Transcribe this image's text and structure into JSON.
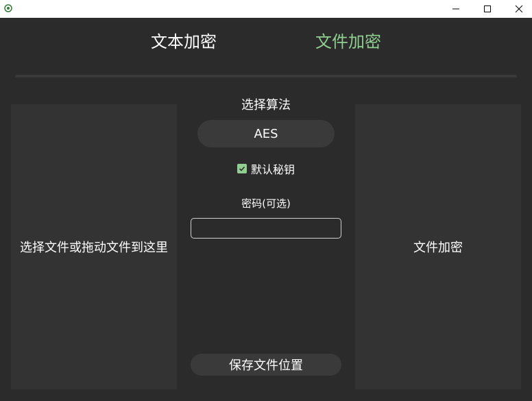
{
  "window": {
    "icons": {
      "app": "app-logo-icon",
      "minimize": "minimize-icon",
      "maximize": "maximize-icon",
      "close": "close-icon"
    }
  },
  "tabs": [
    {
      "label": "文本加密",
      "active": false
    },
    {
      "label": "文件加密",
      "active": true
    }
  ],
  "colors": {
    "background": "#2b2b2b",
    "panel": "#333333",
    "accent": "#8fcf8f"
  },
  "left_panel": {
    "label": "选择文件或拖动文件到这里"
  },
  "algorithm": {
    "label": "选择算法",
    "selected": "AES"
  },
  "default_key": {
    "label": "默认秘钥",
    "checked": true
  },
  "password": {
    "label": "密码(可选)",
    "value": ""
  },
  "save_button": {
    "label": "保存文件位置"
  },
  "right_panel": {
    "label": "文件加密"
  }
}
